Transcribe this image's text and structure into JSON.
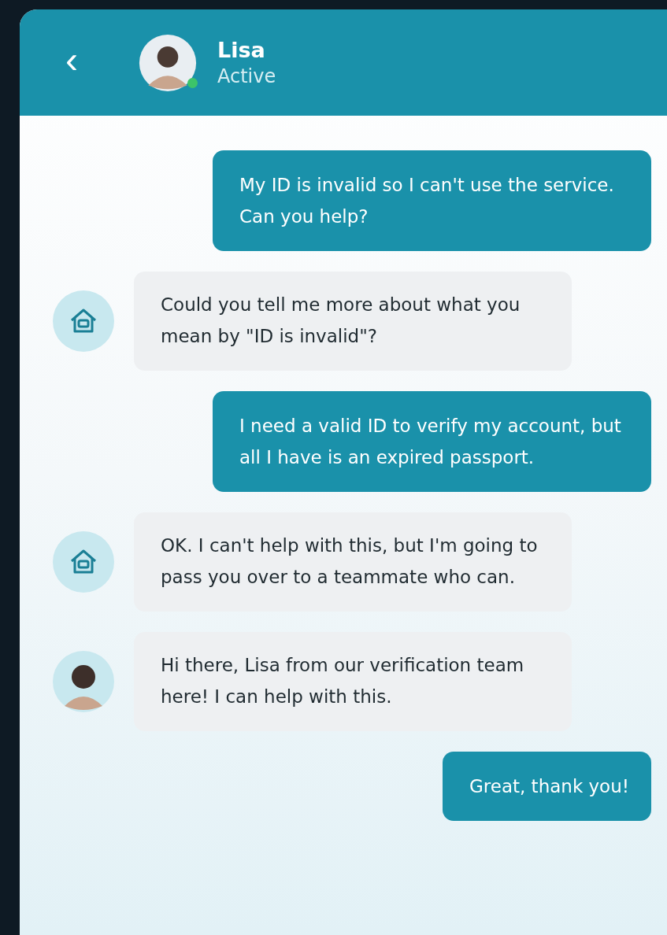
{
  "header": {
    "back": "‹",
    "name": "Lisa",
    "status": "Active",
    "online": true
  },
  "messages": [
    {
      "kind": "sent",
      "text": "My ID is invalid so I can't use the service. Can you help?"
    },
    {
      "kind": "received",
      "avatar": {
        "kind": "bot"
      },
      "text": "Could you tell me more about what you mean by \"ID is invalid\"?"
    },
    {
      "kind": "sent",
      "text": "I need a valid ID to verify my account, but all I have is an expired passport."
    },
    {
      "kind": "received",
      "avatar": {
        "kind": "bot"
      },
      "text": "OK. I can't help with this, but I'm going to pass you over to a teammate who can."
    },
    {
      "kind": "received",
      "avatar": {
        "kind": "agent"
      },
      "text": "Hi there, Lisa from our verification team here! I can help with this."
    },
    {
      "kind": "sent",
      "text": "Great, thank you!"
    }
  ]
}
